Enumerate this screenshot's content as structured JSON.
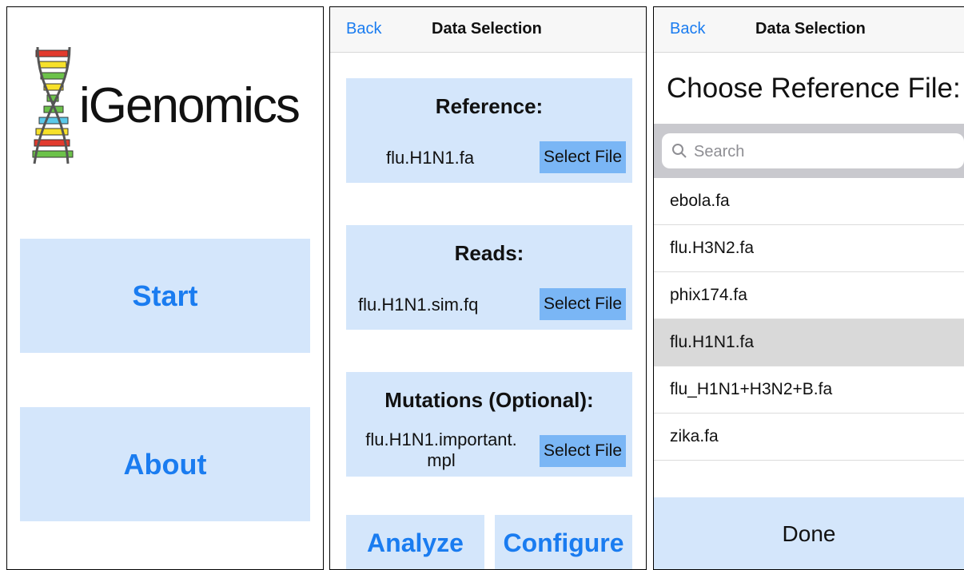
{
  "home": {
    "app_name": "iGenomics",
    "start_label": "Start",
    "about_label": "About"
  },
  "selection": {
    "back_label": "Back",
    "title": "Data Selection",
    "reference": {
      "title": "Reference:",
      "file": "flu.H1N1.fa",
      "button": "Select File"
    },
    "reads": {
      "title": "Reads:",
      "file": "flu.H1N1.sim.fq",
      "button": "Select File"
    },
    "mutations": {
      "title": "Mutations (Optional):",
      "file": "flu.H1N1.important.\nmpl",
      "button": "Select File"
    },
    "analyze_label": "Analyze",
    "configure_label": "Configure"
  },
  "picker": {
    "back_label": "Back",
    "title": "Data Selection",
    "heading": "Choose Reference File:",
    "search_placeholder": "Search",
    "files": [
      "ebola.fa",
      "flu.H3N2.fa",
      "phix174.fa",
      "flu.H1N1.fa",
      "flu_H1N1+H3N2+B.fa",
      "zika.fa"
    ],
    "selected_file": "flu.H1N1.fa",
    "done_label": "Done"
  },
  "colors": {
    "accent": "#1a7cf0",
    "button_bg": "#d4e6fb",
    "select_button_bg": "#7ab6f5",
    "selected_row": "#d9d9d9",
    "search_bar": "#c9c9ce"
  }
}
